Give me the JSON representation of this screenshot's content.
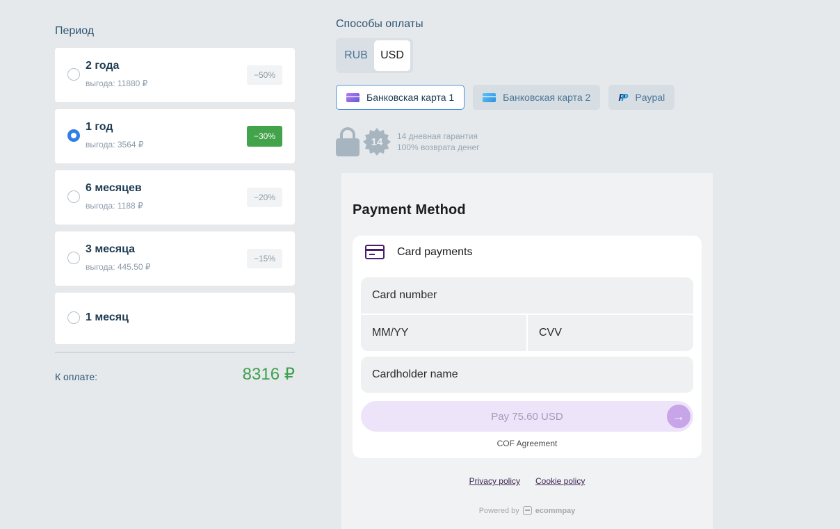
{
  "period": {
    "title": "Период",
    "plans": [
      {
        "name": "2 года",
        "save": "выгода: 11880 ₽",
        "discount": "−50%",
        "selected": false
      },
      {
        "name": "1 год",
        "save": "выгода: 3564 ₽",
        "discount": "−30%",
        "selected": true
      },
      {
        "name": "6 месяцев",
        "save": "выгода: 1188 ₽",
        "discount": "−20%",
        "selected": false
      },
      {
        "name": "3 месяца",
        "save": "выгода: 445.50 ₽",
        "discount": "−15%",
        "selected": false
      },
      {
        "name": "1 месяц",
        "save": "",
        "discount": "",
        "selected": false
      }
    ],
    "total_label": "К оплате:",
    "total_amount": "8316 ₽"
  },
  "payment": {
    "title": "Способы оплаты",
    "currencies": [
      {
        "label": "RUB",
        "active": false
      },
      {
        "label": "USD",
        "active": true
      }
    ],
    "methods": [
      {
        "label": "Банковская карта 1",
        "icon": "card-violet-icon",
        "active": true
      },
      {
        "label": "Банковская карта 2",
        "icon": "card-blue-icon",
        "active": false
      },
      {
        "label": "Paypal",
        "icon": "paypal-icon",
        "active": false
      }
    ],
    "guarantee": {
      "badge_number": "14",
      "line1": "14 дневная гарантия",
      "line2": "100% возврата денег"
    }
  },
  "widget": {
    "title": "Payment Method",
    "card_payments_label": "Card payments",
    "fields": {
      "card_number": "Card number",
      "expiry": "MM/YY",
      "cvv": "CVV",
      "holder": "Cardholder name"
    },
    "pay_button": "Pay 75.60 USD",
    "cof": "COF Agreement",
    "privacy": "Privacy policy",
    "cookie": "Cookie policy",
    "powered_by": "Powered by",
    "brand": "ecommpay"
  },
  "colors": {
    "accent_blue": "#2f7ee8",
    "discount_active": "#43a34a",
    "total_green": "#3ea04c",
    "pay_button_bg": "#ede4fa"
  }
}
